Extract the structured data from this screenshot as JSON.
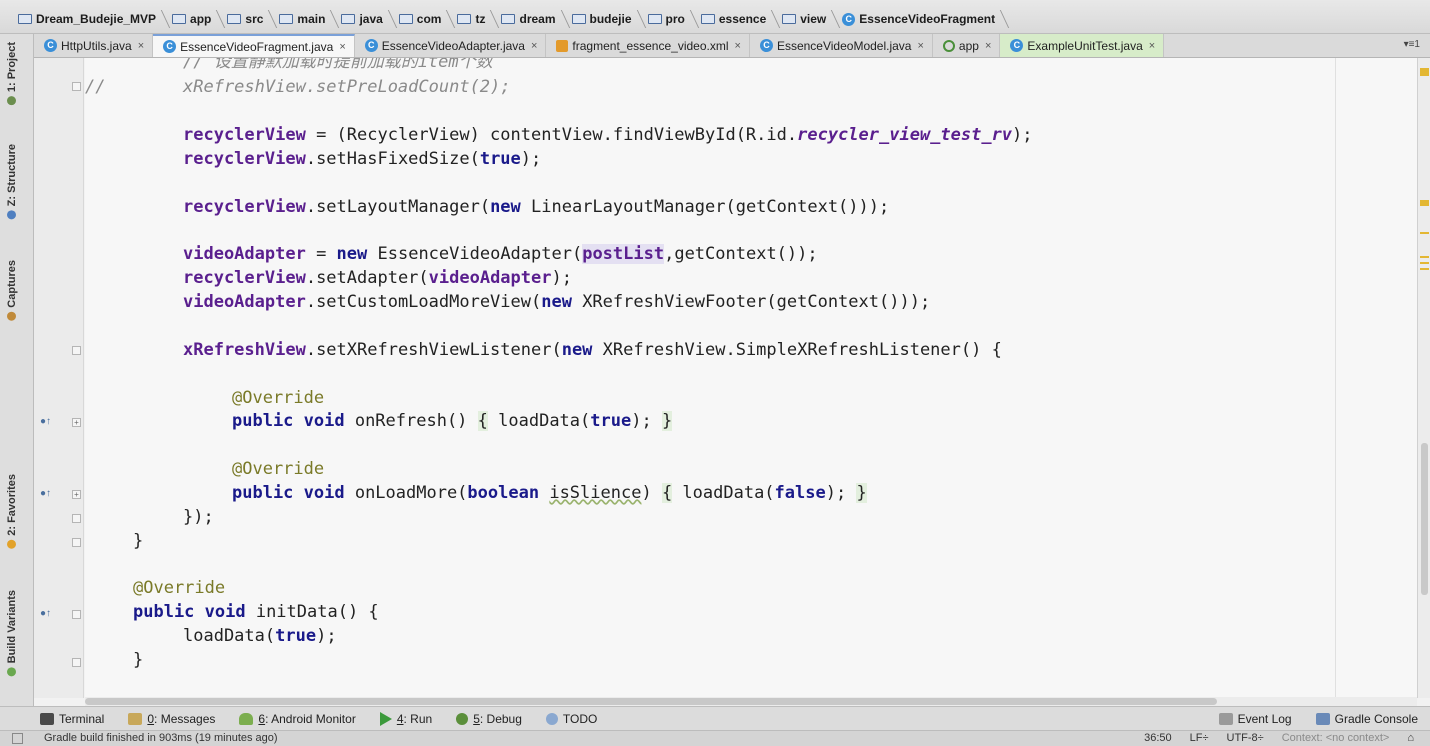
{
  "breadcrumbs": [
    "Dream_Budejie_MVP",
    "app",
    "src",
    "main",
    "java",
    "com",
    "tz",
    "dream",
    "budejie",
    "pro",
    "essence",
    "view",
    "EssenceVideoFragment"
  ],
  "tabs": [
    {
      "label": "HttpUtils.java",
      "icon": "class-icon",
      "active": false
    },
    {
      "label": "EssenceVideoFragment.java",
      "icon": "class-icon",
      "active": true
    },
    {
      "label": "EssenceVideoAdapter.java",
      "icon": "class-icon",
      "active": false
    },
    {
      "label": "fragment_essence_video.xml",
      "icon": "xml-icon",
      "active": false
    },
    {
      "label": "EssenceVideoModel.java",
      "icon": "class-icon",
      "active": false
    },
    {
      "label": "app",
      "icon": "app-icon",
      "active": false
    },
    {
      "label": "ExampleUnitTest.java",
      "icon": "test-class-icon",
      "active": false
    }
  ],
  "tab_close": "×",
  "tab_menu": "▾≡1",
  "left_tools": {
    "project": "1: Project",
    "structure": "Z: Structure",
    "captures": "Captures",
    "favorites": "2: Favorites",
    "build_variants": "Build Variants"
  },
  "code": {
    "l0": "// 设置静默加载时提前加载的item个数",
    "l1_cmt": "//",
    "l1": "xRefreshView.setPreLoadCount(2);",
    "l3_a": "recyclerView",
    "l3_b": " = (RecyclerView) contentView.findViewById(R.id.",
    "l3_c": "recycler_view_test_rv",
    "l3_d": ");",
    "l4_a": "recyclerView",
    "l4_b": ".setHasFixedSize(",
    "l4_c": "true",
    "l4_d": ");",
    "l6_a": "recyclerView",
    "l6_b": ".setLayoutManager(",
    "l6_c": "new",
    "l6_d": " LinearLayoutManager(getContext()));",
    "l8_a": "videoAdapter",
    "l8_b": " = ",
    "l8_c": "new",
    "l8_d": " EssenceVideoAdapter(",
    "l8_e": "postList",
    "l8_f": ",getContext());",
    "l9_a": "recyclerView",
    "l9_b": ".setAdapter(",
    "l9_c": "videoAdapter",
    "l9_d": ");",
    "l10_a": "videoAdapter",
    "l10_b": ".setCustomLoadMoreView(",
    "l10_c": "new",
    "l10_d": " XRefreshViewFooter(getContext()));",
    "l12_a": "xRefreshView",
    "l12_b": ".setXRefreshViewListener(",
    "l12_c": "new",
    "l12_d": " XRefreshView.SimpleXRefreshListener() {",
    "ann": "@Override",
    "l15_a": "public void",
    "l15_b": " onRefresh() ",
    "l15_c": "{",
    "l15_d": " loadData(",
    "l15_e": "true",
    "l15_f": "); ",
    "l15_g": "}",
    "l18_a": "public void",
    "l18_b": " onLoadMore(",
    "l18_c": "boolean",
    "l18_d": " ",
    "l18_e": "isSlience",
    "l18_f": ") ",
    "l18_g": "{",
    "l18_h": " loadData(",
    "l18_i": "false",
    "l18_j": "); ",
    "l18_k": "}",
    "l19": "});",
    "l20": "}",
    "l23_a": "public void",
    "l23_b": " initData() {",
    "l24_a": "loadData(",
    "l24_b": "true",
    "l24_c": ");",
    "l25": "}"
  },
  "bottom_tools": {
    "terminal": "Terminal",
    "messages_key": "0",
    "messages": ": Messages",
    "monitor_key": "6",
    "monitor": ": Android Monitor",
    "run_key": "4",
    "run": ": Run",
    "debug_key": "5",
    "debug": ": Debug",
    "todo": "TODO",
    "event_log": "Event Log",
    "gradle_console": "Gradle Console"
  },
  "status": {
    "message": "Gradle build finished in 903ms (19 minutes ago)",
    "position": "36:50",
    "line_sep": "LF÷",
    "encoding": "UTF-8÷",
    "context": "Context: <no context>"
  },
  "colors": {
    "keyword": "#1a1a8a",
    "field": "#5a1f8e",
    "annotation": "#7a7a28",
    "comment": "#8a8a8a",
    "active_tab_accent": "#7aa0d8"
  }
}
